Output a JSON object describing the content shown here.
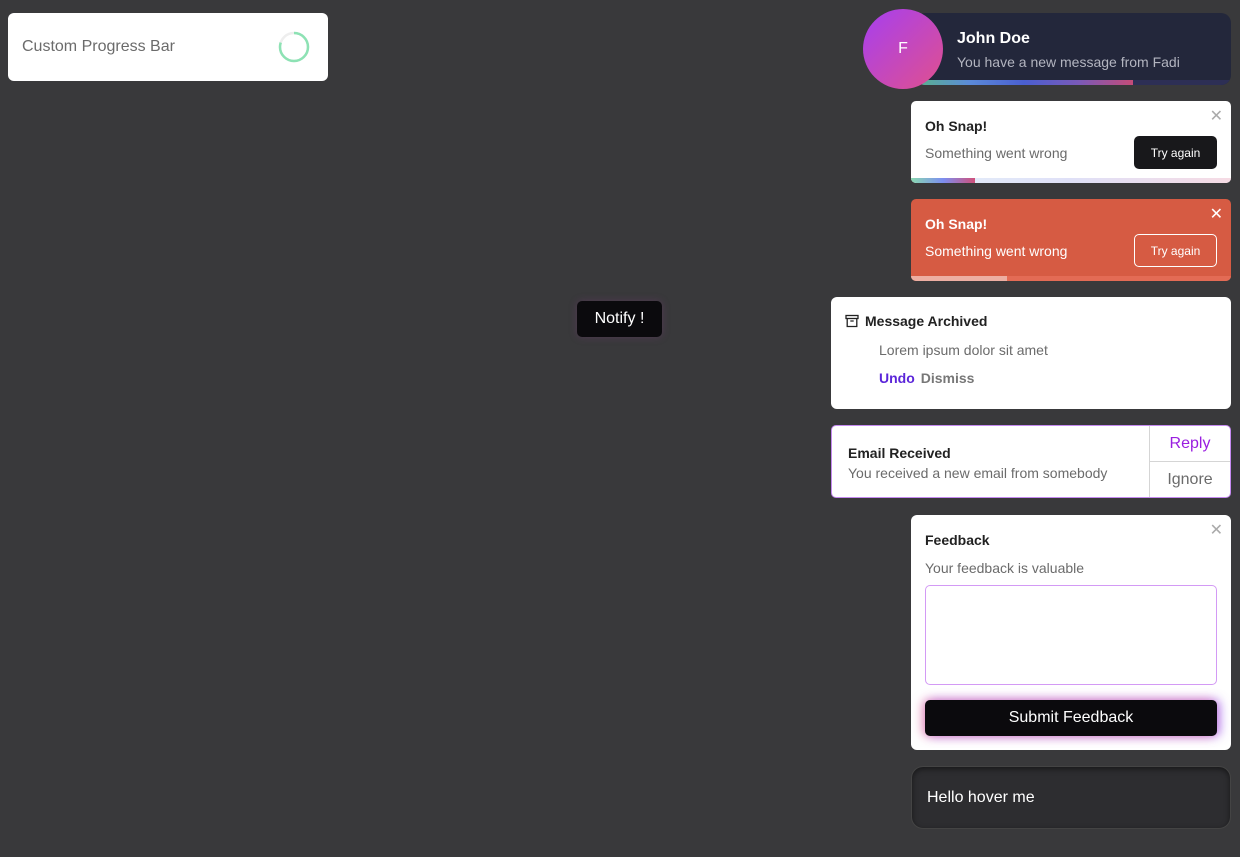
{
  "progress_card": {
    "label": "Custom Progress Bar",
    "progress": 0.8,
    "ring_color": "#8de2b4"
  },
  "notify_button": "Notify !",
  "john": {
    "avatar_letter": "F",
    "name": "John Doe",
    "message": "You have a new message from Fadi",
    "progress": 0.69
  },
  "snap_light": {
    "title": "Oh Snap!",
    "message": "Something went wrong",
    "button": "Try again",
    "close": "✕",
    "progress": 0.2
  },
  "snap_red": {
    "title": "Oh Snap!",
    "message": "Something went wrong",
    "button": "Try again",
    "close": "✕",
    "progress": 0.3,
    "color": "#d65b43"
  },
  "archived": {
    "icon": "archive-icon",
    "title": "Message Archived",
    "body": "Lorem ipsum dolor sit amet",
    "undo": "Undo",
    "dismiss": "Dismiss"
  },
  "email": {
    "title": "Email Received",
    "message": "You received a new email from somebody",
    "reply": "Reply",
    "ignore": "Ignore"
  },
  "feedback": {
    "title": "Feedback",
    "subtitle": "Your feedback is valuable",
    "close": "✕",
    "textarea_value": "",
    "submit": "Submit Feedback"
  },
  "hover_card": "Hello hover me"
}
